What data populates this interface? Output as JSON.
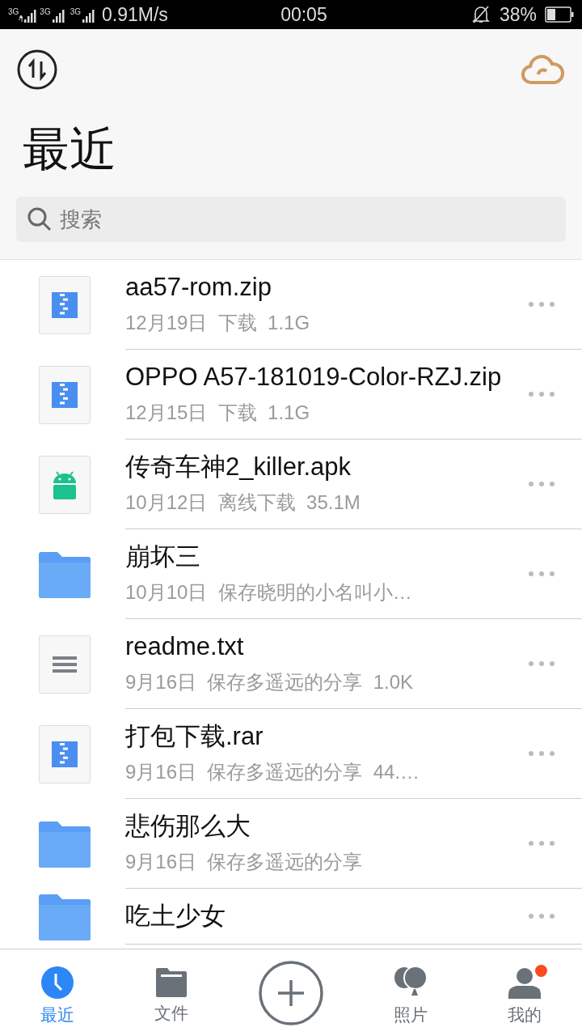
{
  "status_bar": {
    "signals": [
      {
        "label": "3G",
        "kind": "data"
      },
      {
        "label": "3G",
        "kind": "plain"
      },
      {
        "label": "3G",
        "kind": "plain"
      }
    ],
    "speed": "0.91M/s",
    "time": "00:05",
    "battery": "38%"
  },
  "header": {
    "title": "最近"
  },
  "search": {
    "placeholder": "搜索"
  },
  "files": [
    {
      "kind": "zip",
      "name": "aa57-rom.zip",
      "meta": "12月19日  下载  1.1G"
    },
    {
      "kind": "zip",
      "name": "OPPO A57-181019-Color-RZJ.zip",
      "meta": "12月15日  下载  1.1G"
    },
    {
      "kind": "apk",
      "name": "传奇车神2_killer.apk",
      "meta": "10月12日  离线下载  35.1M"
    },
    {
      "kind": "folder",
      "name": "崩坏三",
      "meta": "10月10日  保存晓明的小名叫小…"
    },
    {
      "kind": "txt",
      "name": "readme.txt",
      "meta": "9月16日  保存多遥远的分享  1.0K"
    },
    {
      "kind": "zip",
      "name": "打包下载.rar",
      "meta": "9月16日  保存多遥远的分享  44.…"
    },
    {
      "kind": "folder",
      "name": "悲伤那么大",
      "meta": "9月16日  保存多遥远的分享"
    },
    {
      "kind": "folder",
      "name": "吃土少女"
    }
  ],
  "nav": [
    {
      "kind": "recent",
      "label": "最近",
      "selected": true,
      "badge": false
    },
    {
      "kind": "files",
      "label": "文件",
      "selected": false,
      "badge": false
    },
    {
      "kind": "add"
    },
    {
      "kind": "photos",
      "label": "照片",
      "selected": false,
      "badge": false
    },
    {
      "kind": "me",
      "label": "我的",
      "selected": false,
      "badge": true
    }
  ]
}
